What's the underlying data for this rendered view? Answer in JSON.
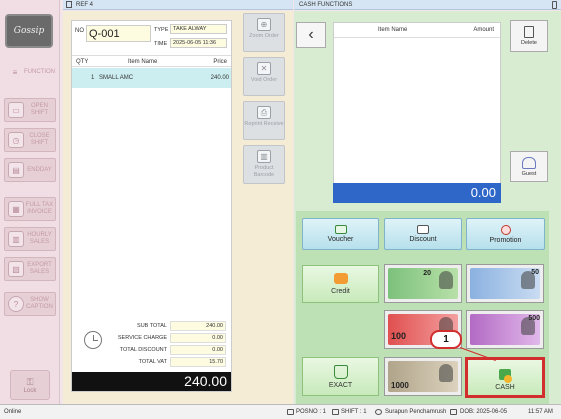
{
  "sidebar": {
    "logo_text": "Gossip",
    "items": [
      {
        "label": "FUNCTION",
        "icon": "menu-icon"
      },
      {
        "label": "OPEN SHIFT",
        "icon": "open-shift-icon"
      },
      {
        "label": "CLOSE SHIFT",
        "icon": "clock-icon"
      },
      {
        "label": "ENDDAY",
        "icon": "cash-drawer-icon"
      },
      {
        "label": "FULL TAX INVOICE",
        "icon": "invoice-icon"
      },
      {
        "label": "HOURLY SALES",
        "icon": "report-icon"
      },
      {
        "label": "EXPORT SALES",
        "icon": "export-icon"
      },
      {
        "label": "SHOW CAPTION",
        "icon": "help-icon"
      }
    ],
    "lock_label": "Lock"
  },
  "ref_panel": {
    "title": "REF 4",
    "no_label": "NO",
    "order_no": "Q-001",
    "type_label": "TYPE",
    "type_value": "TAKE ALWAY",
    "time_label": "TIME",
    "time_value": "2025-06-05 11:36",
    "columns": {
      "qty": "QTY",
      "item": "Item Name",
      "price": "Price"
    },
    "items": [
      {
        "qty": "1",
        "name": "SMALL AMC",
        "price": "240.00"
      }
    ],
    "totals": [
      {
        "label": "SUB TOTAL",
        "value": "240.00"
      },
      {
        "label": "SERVICE CHARGE",
        "value": "0.00"
      },
      {
        "label": "TOTAL DISCOUNT",
        "value": "0.00"
      },
      {
        "label": "TOTAL VAT",
        "value": "15.70"
      }
    ],
    "grand_total": "240.00",
    "tools": [
      {
        "label": "Zoom Order",
        "icon": "zoom-icon"
      },
      {
        "label": "Void Order",
        "icon": "void-icon"
      },
      {
        "label": "Reprint Receive",
        "icon": "printer-icon"
      },
      {
        "label": "Product Barcode",
        "icon": "barcode-icon"
      }
    ]
  },
  "cash_panel": {
    "title": "CASH FUNCTIONS",
    "list_header_item": "Item Name",
    "list_header_amount": "Amount",
    "amount_display": "0.00",
    "delete_label": "Delete",
    "guest_label": "Guest",
    "voucher_label": "Voucher",
    "discount_label": "Discount",
    "promotion_label": "Promotion",
    "credit_label": "Credit",
    "exact_label": "EXACT",
    "cash_label": "CASH",
    "banknotes": [
      "20",
      "50",
      "100",
      "500",
      "1000"
    ],
    "callout": "1",
    "highlight_color": "#d32e2e"
  },
  "statusbar": {
    "online": "Online",
    "posno": "POSNO : 1",
    "shift": "SHIFT : 1",
    "user": "Surapun Penchamrush",
    "dob": "DOB: 2025-06-05",
    "time": "11:57 AM"
  }
}
